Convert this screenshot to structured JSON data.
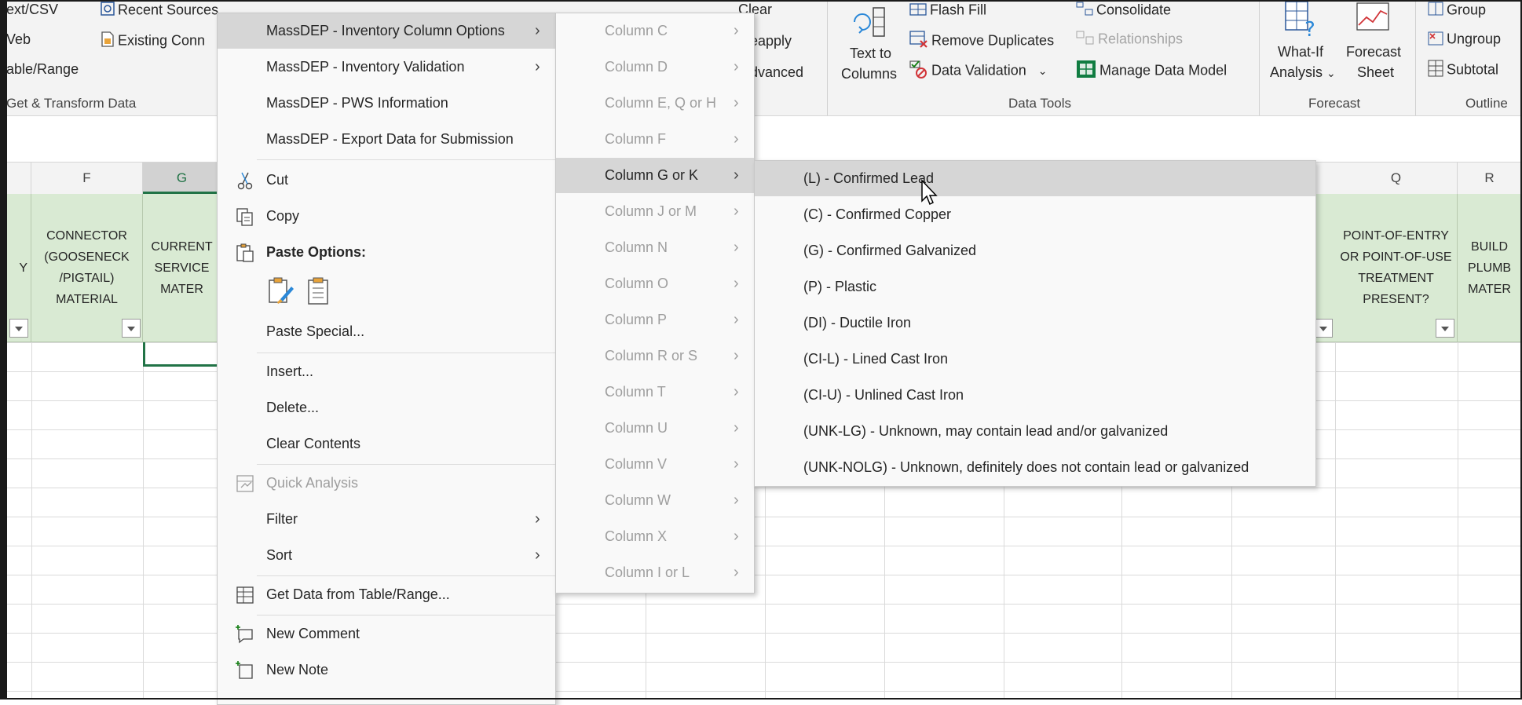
{
  "ribbon": {
    "get_transform": {
      "text_csv": "ext/CSV",
      "web": "Veb",
      "table_range": "able/Range",
      "recent_sources": "Recent Sources",
      "existing_conn": "Existing Conn",
      "group_label": "Get & Transform Data"
    },
    "sort_filter": {
      "clear": "Clear",
      "reapply": "eapply",
      "advanced": "dvanced"
    },
    "data_tools": {
      "text_to_columns_1": "Text to",
      "text_to_columns_2": "Columns",
      "flash_fill": "Flash Fill",
      "remove_duplicates": "Remove Duplicates",
      "data_validation": "Data Validation",
      "consolidate": "Consolidate",
      "relationships": "Relationships",
      "manage_data_model": "Manage Data Model",
      "group_label": "Data Tools"
    },
    "forecast": {
      "what_if_1": "What-If",
      "what_if_2": "Analysis",
      "forecast_sheet_1": "Forecast",
      "forecast_sheet_2": "Sheet",
      "group_label": "Forecast"
    },
    "outline": {
      "group": "Group",
      "ungroup": "Ungroup",
      "subtotal": "Subtotal",
      "group_label": "Outline"
    }
  },
  "sheet": {
    "columns": [
      "F",
      "G",
      "Q",
      "R"
    ],
    "headers": {
      "f": "CONNECTOR (GOOSENECK /PIGTAIL) MATERIAL",
      "g": "CURRENT SERVICE MATER",
      "q": "POINT-OF-ENTRY OR POINT-OF-USE TREATMENT PRESENT?",
      "r": "BUILD PLUMB MATER",
      "left_edge": "Y"
    }
  },
  "context_menu": {
    "items": [
      "MassDEP - Inventory Column Options",
      "MassDEP - Inventory Validation",
      "MassDEP - PWS Information",
      "MassDEP - Export Data for Submission",
      "Cut",
      "Copy",
      "Paste Options:",
      "Paste Special...",
      "Insert...",
      "Delete...",
      "Clear Contents",
      "Quick Analysis",
      "Filter",
      "Sort",
      "Get Data from Table/Range...",
      "New Comment",
      "New Note"
    ]
  },
  "column_submenu": {
    "items": [
      "Column C",
      "Column D",
      "Column E, Q or H",
      "Column F",
      "Column G or K",
      "Column J or M",
      "Column N",
      "Column O",
      "Column P",
      "Column R or S",
      "Column T",
      "Column U",
      "Column V",
      "Column W",
      "Column X",
      "Column I or L"
    ],
    "active_index": 4
  },
  "material_submenu": {
    "items": [
      "(L) - Confirmed Lead",
      "(C) - Confirmed Copper",
      "(G) - Confirmed Galvanized",
      "(P) - Plastic",
      "(DI) - Ductile Iron",
      "(CI-L) - Lined Cast Iron",
      "(CI-U) - Unlined Cast Iron",
      "(UNK-LG) - Unknown, may contain lead and/or galvanized",
      "(UNK-NOLG) - Unknown, definitely does not contain lead or galvanized"
    ],
    "active_index": 0
  },
  "colors": {
    "accent": "#217346",
    "header_fill": "#d9ead3",
    "menu_highlight": "#d6d6d6"
  }
}
